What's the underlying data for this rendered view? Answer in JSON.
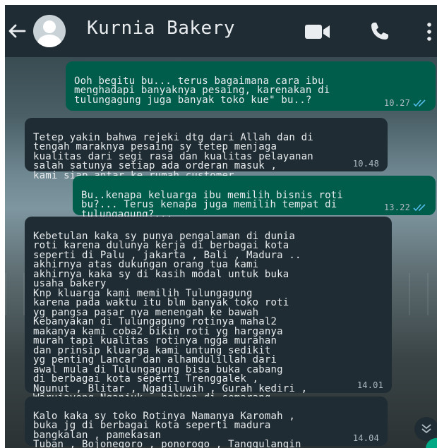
{
  "header": {
    "contact_name": "Kurnia Bakery",
    "icons": [
      "back-arrow-icon",
      "avatar",
      "video-call-icon",
      "phone-call-icon",
      "more-options-icon"
    ]
  },
  "messages": [
    {
      "direction": "outgoing",
      "text": "Ooh begitu bu... terus bagaimana cara ibu\nmenghadapi banyaknya pesaing, karenakan di\ntulungagung juga banyak toko kue\" bu..?",
      "time": "10.27",
      "status": "read"
    },
    {
      "direction": "incoming",
      "text": "Tetep yakin bahwa rejeki dtg dari Allah dan di\ntengah maraknya pesaing sy tetep menjaga\nkualitas dari segi rasa dan kualitas pelayanan\nsalah satunya setiap ada orderan masuk ,\nkami siap antar ke rumah customer",
      "time": "10.48"
    },
    {
      "direction": "outgoing",
      "text": "Bu..kenapa keluarga ibu memilih bisnis roti\nbu?... Terus kenapa juga memilih tempat di\ntulungagung?...",
      "time": "13.22",
      "status": "read"
    },
    {
      "direction": "incoming",
      "text": "Kebetulan kaka sy punya pengalaman di dunia\nroti karena dulunya kerja di berbagai kota\nseperti di Palu , jakarta , Bali , Madura ..\nakhirnya atas dukungan orang tua kami\nakhirnya kaka sy di kasih modal untuk buka\nusaha bakery\nKnp kluarga kami memilih Tulungagung\nkarena pada waktu itu blm banyak toko roti\nyg pangsa pasar nya menengah ke bawah\nKebanyakan di Tulungagung rotinya mahal2\nmakanya kami coba2 bikin roti yg harganya\nmurah tapi kualitas rotinya ngga murahan\ndan prinsip kluarga kami untung sedikit\nyg penting Lancar dan alhamdulillah dari\nawal mula di Tulungagung bisa buka cabang\ndi berbagai kota seperti Trenggalek ,\nNgunut , Blitar , Ngadiluwih , Gurah kediri ,\nWarujayeng Nganjuk , bahkan di semarang\njuga ada",
      "time": "14.01"
    },
    {
      "direction": "incoming",
      "text": "Kalo kaka sy toko Rotinya Namanya Karomah ,\nbuka jg di berbagai kota seperti madura\nbangkalan , pamekasan\nTuban , Bojonegoro , ponorogo , Tanggulangin\nsidoarjo , Gresik , Nganjuk",
      "time": "14.04"
    }
  ],
  "colors": {
    "header_bg": "#1f2c33",
    "outgoing_bubble": "#005c4b",
    "incoming_bubble": "#1f2c33",
    "text": "#e9edef",
    "timestamp": "#aebac1",
    "read_ticks": "#53bdeb",
    "fab": "#00a884"
  }
}
